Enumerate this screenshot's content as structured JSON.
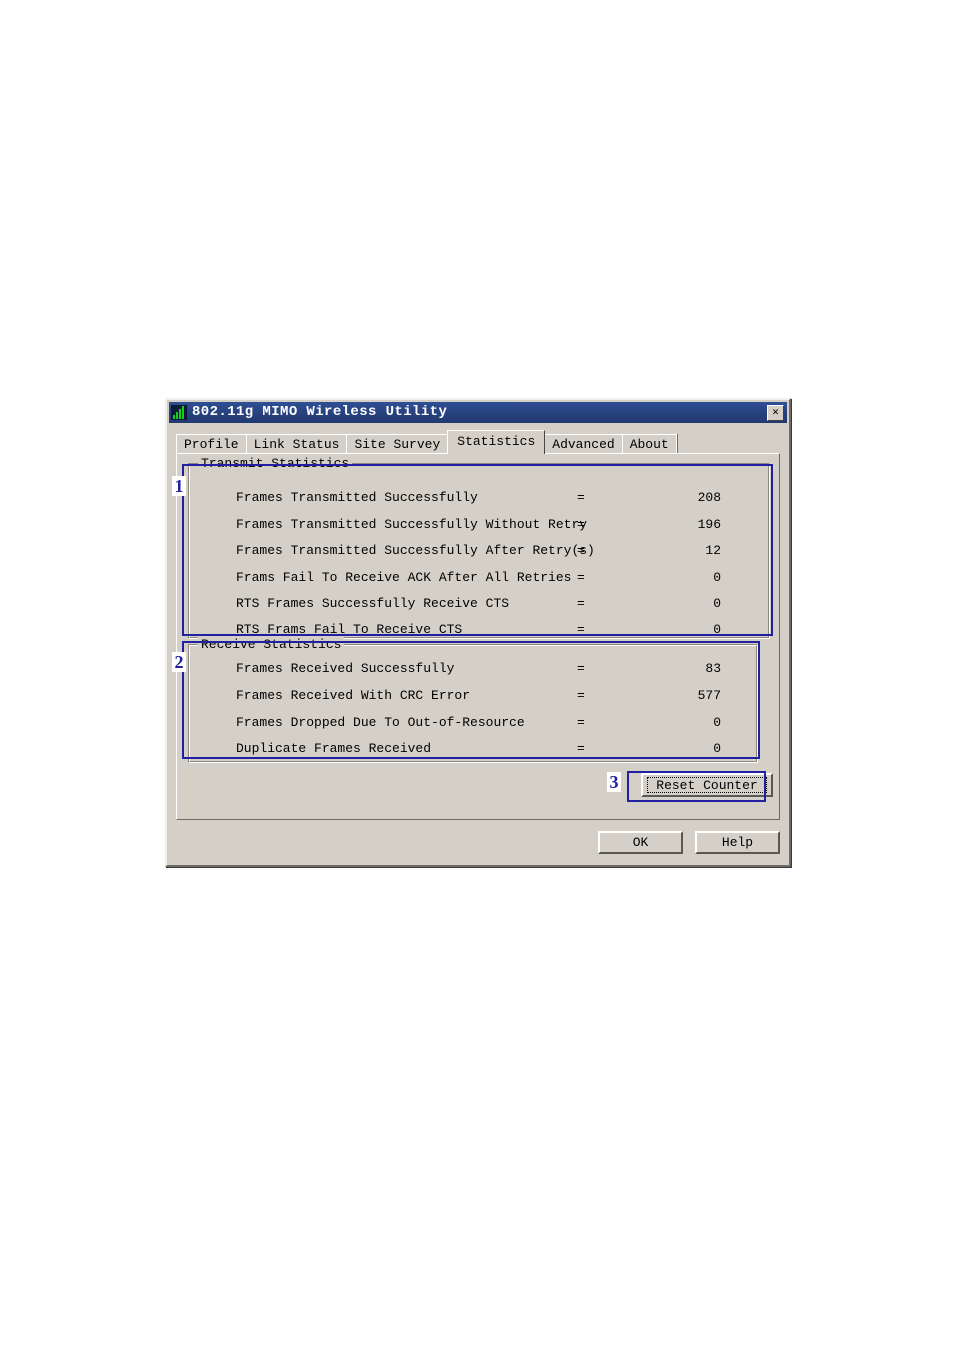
{
  "window": {
    "title": "802.11g MIMO Wireless Utility",
    "icon": "signal-bars-icon",
    "close_label": "✕",
    "titlebar_color": "#27417c",
    "face_color": "#d4d0c8"
  },
  "tabs": [
    {
      "label": "Profile",
      "active": false
    },
    {
      "label": "Link Status",
      "active": false
    },
    {
      "label": "Site Survey",
      "active": false
    },
    {
      "label": "Statistics",
      "active": true
    },
    {
      "label": "Advanced",
      "active": false
    },
    {
      "label": "About",
      "active": false
    }
  ],
  "transmit": {
    "title": "Transmit Statistics",
    "equals": "=",
    "rows": [
      {
        "label": "Frames Transmitted Successfully",
        "value": "208"
      },
      {
        "label": "Frames Transmitted Successfully Without Retry",
        "value": "196"
      },
      {
        "label": "Frames Transmitted Successfully After Retry(s)",
        "value": "12"
      },
      {
        "label": "Frams Fail To Receive ACK After All Retries",
        "value": "0"
      },
      {
        "label": "RTS Frames Successfully Receive CTS",
        "value": "0"
      },
      {
        "label": "RTS Frams Fail To Receive CTS",
        "value": "0"
      }
    ]
  },
  "receive": {
    "title": "Receive Statistics",
    "equals": "=",
    "rows": [
      {
        "label": "Frames Received Successfully",
        "value": "83"
      },
      {
        "label": "Frames Received With CRC Error",
        "value": "577"
      },
      {
        "label": "Frames Dropped Due To Out-of-Resource",
        "value": "0"
      },
      {
        "label": "Duplicate Frames Received",
        "value": "0"
      }
    ]
  },
  "buttons": {
    "reset_counter": "Reset Counter",
    "ok": "OK",
    "help": "Help"
  },
  "annotations": {
    "color": "#2020a0",
    "items": [
      {
        "number": "1",
        "target": "transmit-statistics-group"
      },
      {
        "number": "2",
        "target": "receive-statistics-group"
      },
      {
        "number": "3",
        "target": "reset-counter-button"
      }
    ]
  }
}
